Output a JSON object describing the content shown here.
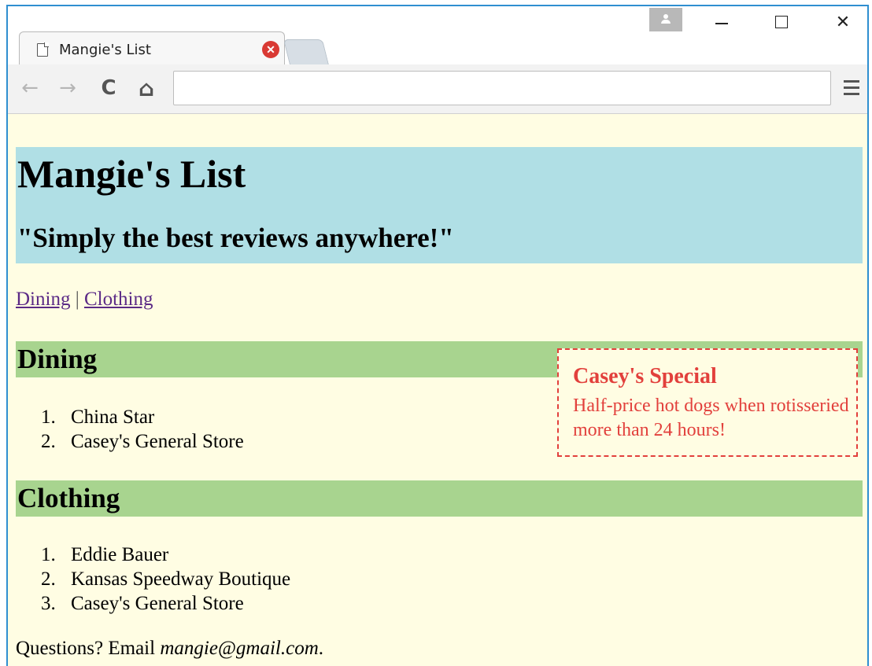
{
  "browser": {
    "tab_title": "Mangie's List",
    "tab_close_icon": "close-circle-icon",
    "address": "",
    "buttons": {
      "back": "←",
      "forward": "→",
      "reload": "C",
      "home": "⌂"
    },
    "window_controls": {
      "close": "✕"
    }
  },
  "page": {
    "title": "Mangie's List",
    "tagline": "\"Simply the best reviews anywhere!\"",
    "nav": {
      "link1": "Dining",
      "separator": "|",
      "link2": "Clothing"
    },
    "sections": [
      {
        "heading": "Dining",
        "items": [
          {
            "num": "1.",
            "text": "China Star"
          },
          {
            "num": "2.",
            "text": "Casey's General Store"
          }
        ]
      },
      {
        "heading": "Clothing",
        "items": [
          {
            "num": "1.",
            "text": "Eddie Bauer"
          },
          {
            "num": "2.",
            "text": "Kansas Speedway Boutique"
          },
          {
            "num": "3.",
            "text": "Casey's General Store"
          }
        ]
      }
    ],
    "special": {
      "title": "Casey's Special",
      "body": "Half-price hot dogs when rotisseried more than 24 hours!"
    },
    "footer": {
      "prefix": "Questions? Email ",
      "email": "mangie@gmail.com",
      "suffix": "."
    }
  },
  "colors": {
    "page_bg": "#fffde3",
    "header_bg": "#b0dfe5",
    "section_bg": "#a8d48f",
    "special_red": "#e2403c",
    "link_purple": "#5b2a86"
  }
}
